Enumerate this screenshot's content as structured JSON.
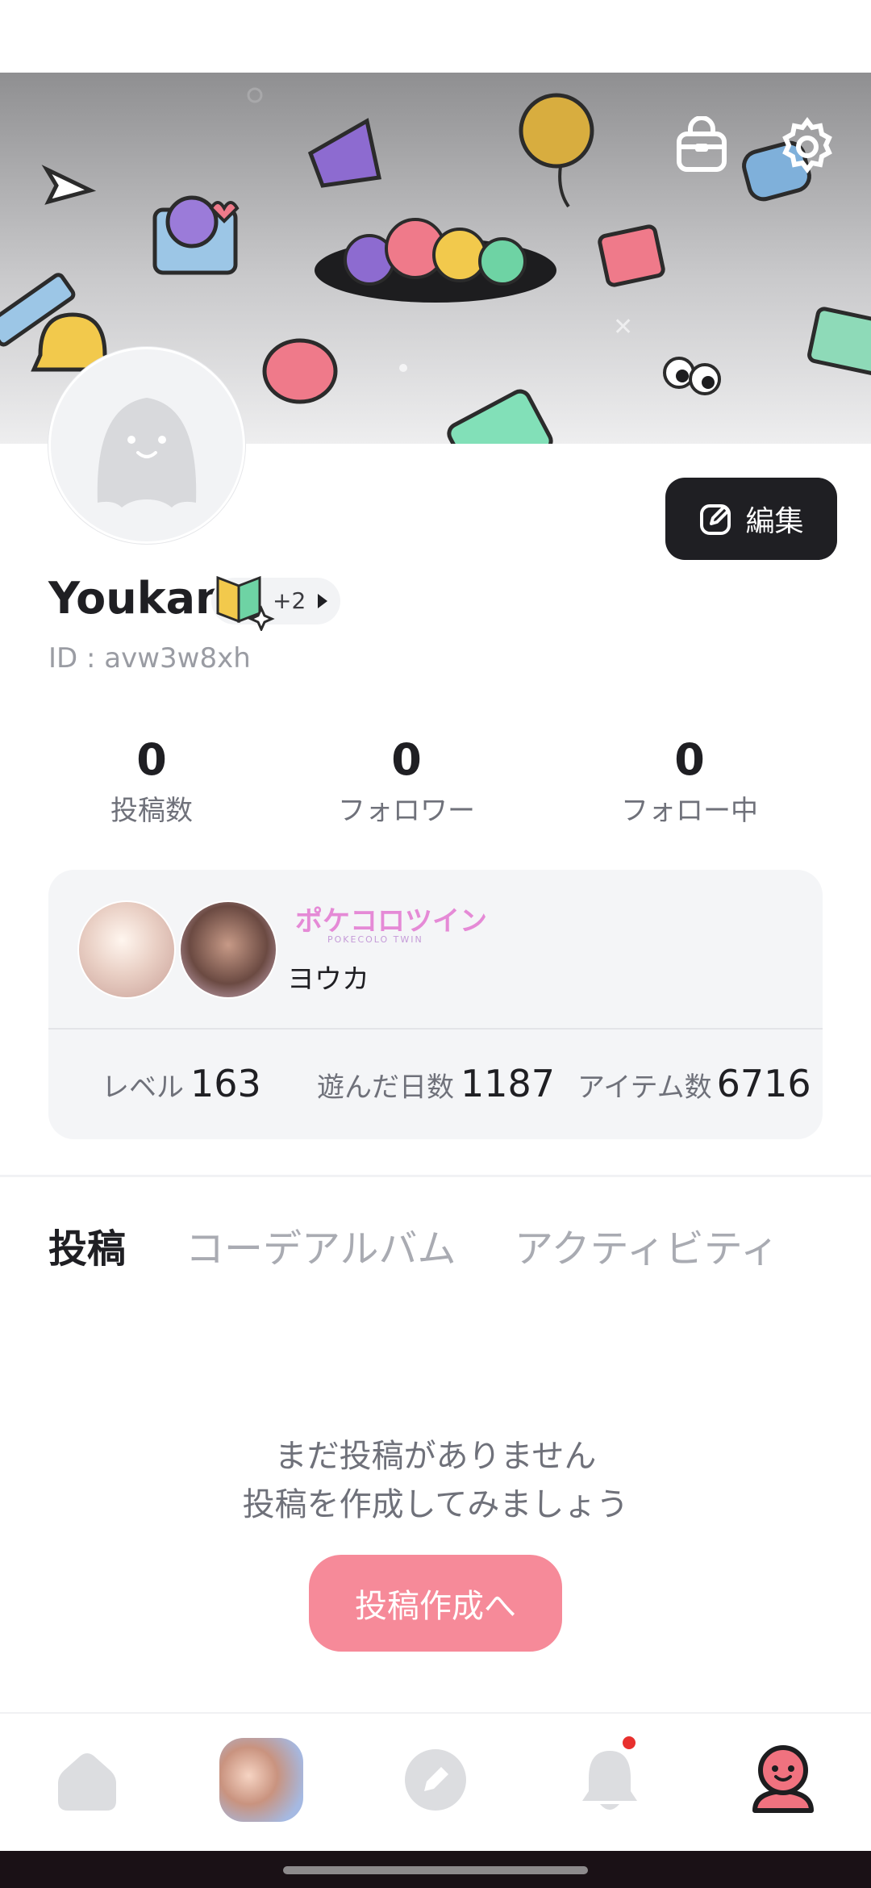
{
  "profile": {
    "username": "Youkan",
    "badge_more": "+2",
    "user_id": "ID : avw3w8xh",
    "edit_label": "編集"
  },
  "stats": [
    {
      "value": "0",
      "label": "投稿数"
    },
    {
      "value": "0",
      "label": "フォロワー"
    },
    {
      "value": "0",
      "label": "フォロー中"
    }
  ],
  "game_card": {
    "logo_text": "ポケコロツイン",
    "logo_sub": "POKECOLO TWIN",
    "character_name": "ヨウカ",
    "level_label": "レベル",
    "level_value": "163",
    "days_label": "遊んだ日数",
    "days_value": "1187",
    "items_label": "アイテム数",
    "items_value": "6716"
  },
  "tabs": [
    {
      "label": "投稿",
      "active": true
    },
    {
      "label": "コーデアルバム",
      "active": false
    },
    {
      "label": "アクティビティ",
      "active": false
    }
  ],
  "empty_state": {
    "line1": "まだ投稿がありません",
    "line2": "投稿を作成してみましょう",
    "button": "投稿作成へ"
  },
  "bottom_nav": {
    "items": [
      "home-icon",
      "game-avatar",
      "compose-icon",
      "bell-icon",
      "profile-icon"
    ],
    "active": "profile-icon",
    "notification_dot": true
  },
  "colors": {
    "accent_pink": "#f68a99",
    "dark_button": "#1f1f23",
    "profile_active": "#f0727f",
    "notification": "#e8302e"
  }
}
